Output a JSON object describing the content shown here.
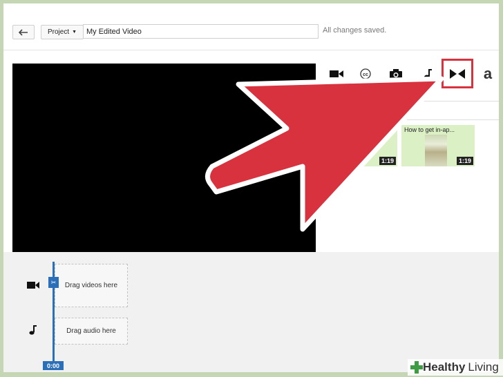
{
  "header": {
    "project_label": "Project",
    "title_value": "My Edited Video",
    "save_status": "All changes saved."
  },
  "toolbar": {
    "tools": [
      {
        "icon": "video-camera-icon"
      },
      {
        "icon": "closed-captions-icon"
      },
      {
        "icon": "photo-camera-icon"
      },
      {
        "icon": "music-note-icon"
      },
      {
        "icon": "transitions-icon",
        "active": true
      },
      {
        "icon": "text-icon",
        "label": "a"
      }
    ]
  },
  "clips": [
    {
      "title": "",
      "duration": "1:19"
    },
    {
      "title": "How to get in-ap...",
      "duration": "1:19"
    }
  ],
  "timeline": {
    "video_drop": "Drag videos here",
    "audio_drop": "Drag audio here",
    "time": "0:00"
  },
  "watermark": {
    "brand_strong": "Healthy",
    "brand_light": "Living"
  },
  "colors": {
    "highlight": "#d7323e",
    "playhead": "#2a6fb7",
    "clip_bg": "#dbf0c5"
  }
}
